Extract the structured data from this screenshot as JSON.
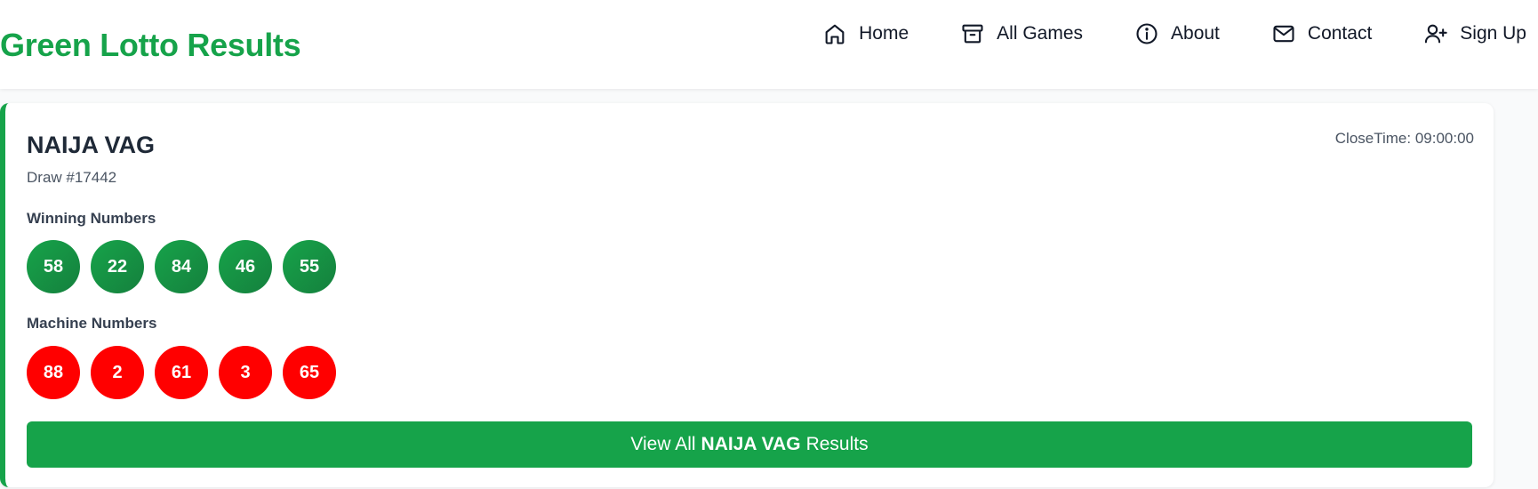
{
  "header": {
    "brand": "Green Lotto Results",
    "brand_color": "#16a34a",
    "nav": [
      {
        "label": "Home",
        "icon": "home-icon"
      },
      {
        "label": "All Games",
        "icon": "archive-icon"
      },
      {
        "label": "About",
        "icon": "info-icon"
      },
      {
        "label": "Contact",
        "icon": "mail-icon"
      },
      {
        "label": "Sign Up",
        "icon": "user-plus-icon"
      }
    ]
  },
  "game": {
    "title": "NAIJA VAG",
    "draw": "Draw #17442",
    "close_time": "CloseTime: 09:00:00",
    "winning_label": "Winning Numbers",
    "winning_numbers": [
      "58",
      "22",
      "84",
      "46",
      "55"
    ],
    "machine_label": "Machine Numbers",
    "machine_numbers": [
      "88",
      "2",
      "61",
      "3",
      "65"
    ],
    "button": {
      "prefix": "View All",
      "game": "NAIJA VAG",
      "suffix": "Results"
    }
  },
  "colors": {
    "winning_ball": "#16a34a",
    "machine_ball": "#ff0000",
    "accent": "#16a34a"
  }
}
